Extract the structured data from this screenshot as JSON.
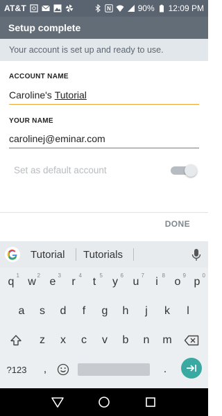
{
  "status_bar": {
    "carrier": "AT&T",
    "battery": "90%",
    "time": "12:09 PM",
    "icons": [
      "carrier-badge-icon",
      "mail-icon",
      "image-icon",
      "pinwheel-icon",
      "bluetooth-icon",
      "nfc-icon",
      "wifi-icon",
      "signal-icon",
      "battery-icon"
    ]
  },
  "header": {
    "title": "Setup complete"
  },
  "banner": {
    "text": "Your account is set up and ready to use."
  },
  "form": {
    "account_name_label": "ACCOUNT NAME",
    "account_name_first": "Caroline's ",
    "account_name_second": "Tutorial",
    "your_name_label": "YOUR NAME",
    "your_name_value": "carolinej@eminar.com",
    "default_label": "Set as default account",
    "default_enabled": true
  },
  "actions": {
    "done_label": "DONE"
  },
  "keyboard": {
    "suggestions": [
      "Tutorial",
      "Tutorials"
    ],
    "row1": [
      "q",
      "w",
      "e",
      "r",
      "t",
      "y",
      "u",
      "i",
      "o",
      "p"
    ],
    "row1_hints": [
      "1",
      "2",
      "3",
      "4",
      "5",
      "6",
      "7",
      "8",
      "9",
      "0"
    ],
    "row2": [
      "a",
      "s",
      "d",
      "f",
      "g",
      "h",
      "j",
      "k",
      "l"
    ],
    "row3": [
      "z",
      "x",
      "c",
      "v",
      "b",
      "n",
      "m"
    ],
    "symbols_label": "?123",
    "comma": ",",
    "period": "."
  },
  "colors": {
    "status_bar": "#5a6470",
    "title_bar": "#626d78",
    "banner": "#e2e7ec",
    "focus_underline": "#f0a534",
    "enter_key": "#3aa9a1"
  }
}
